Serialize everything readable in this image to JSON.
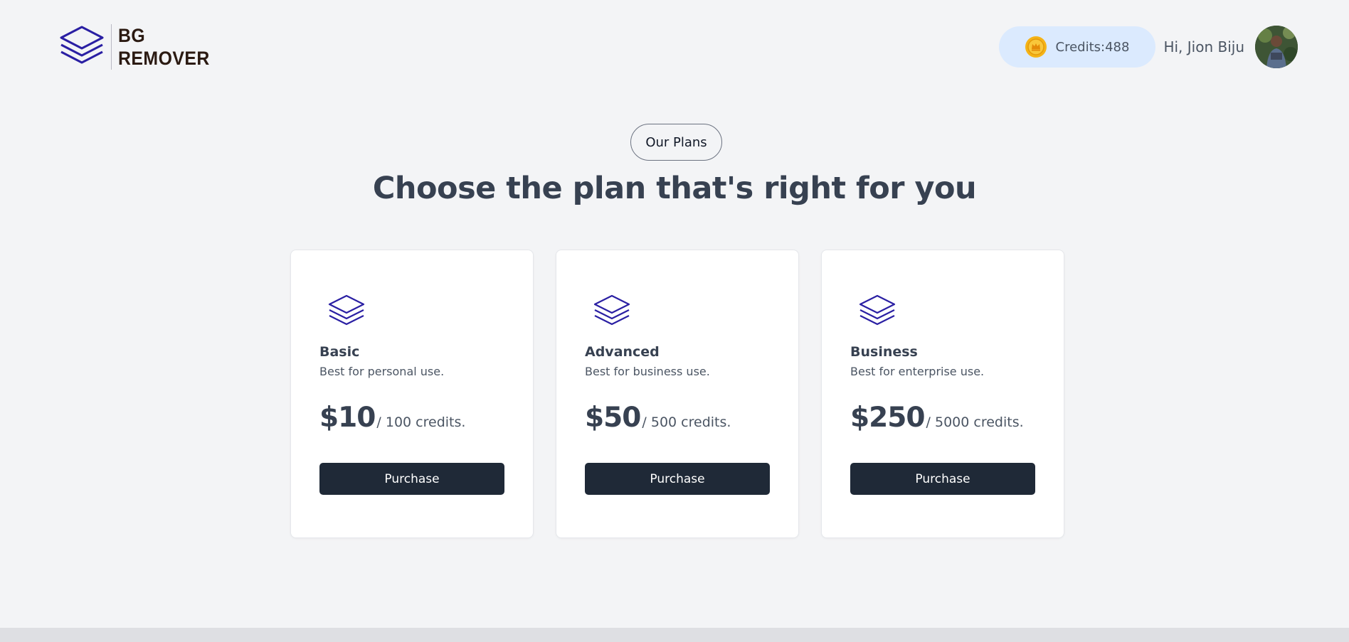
{
  "brand": {
    "line1": "BG",
    "line2": "REMOVER",
    "logo_icon": "layers-icon",
    "accent_color": "#2a1fa3"
  },
  "user": {
    "credits_label": "Credits:488",
    "greeting": "Hi, Jion Biju",
    "coin_icon": "crown-coin-icon"
  },
  "section": {
    "badge": "Our Plans",
    "title": "Choose the plan that's right for you"
  },
  "plans": [
    {
      "name": "Basic",
      "description": "Best for personal use.",
      "price": "$10",
      "per": "/ 100 credits.",
      "button": "Purchase",
      "icon": "layers-icon"
    },
    {
      "name": "Advanced",
      "description": "Best for business use.",
      "price": "$50",
      "per": "/ 500 credits.",
      "button": "Purchase",
      "icon": "layers-icon"
    },
    {
      "name": "Business",
      "description": "Best for enterprise use.",
      "price": "$250",
      "per": "/ 5000 credits.",
      "button": "Purchase",
      "icon": "layers-icon"
    }
  ],
  "colors": {
    "background": "#f3f4f6",
    "button": "#1f2937",
    "credits_pill": "#dbeafe",
    "coin": "#f5b316"
  }
}
